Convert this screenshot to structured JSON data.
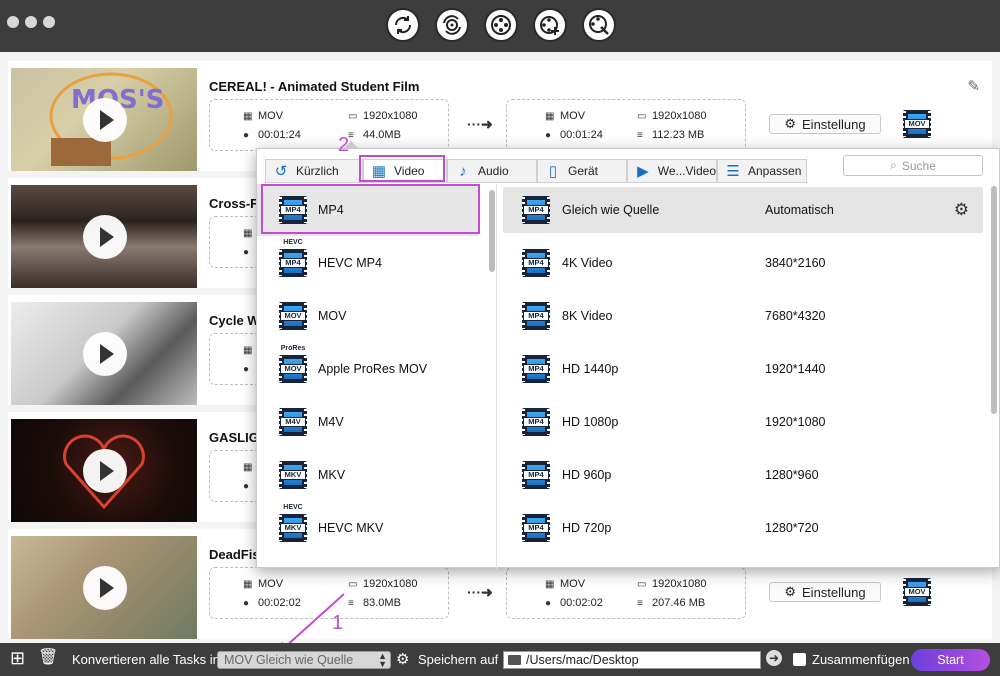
{
  "toolbar": {
    "icons": [
      "convert-icon",
      "rip-dvd-icon",
      "video-edit-icon",
      "merge-icon",
      "toolbox-icon"
    ]
  },
  "tasks": [
    {
      "title": "CEREAL! - Animated Student Film",
      "source": {
        "format": "MOV",
        "resolution": "1920x1080",
        "duration": "00:01:24",
        "size": "44.0MB"
      },
      "target": {
        "format": "MOV",
        "resolution": "1920x1080",
        "duration": "00:01:24",
        "size": "112.23 MB"
      },
      "settings_label": "Einstellung",
      "output_badge": "MOV"
    },
    {
      "title": "Cross-F",
      "source": {
        "format": "",
        "resolution": "",
        "duration": "",
        "size": ""
      }
    },
    {
      "title": "Cycle W",
      "source": {
        "format": "",
        "resolution": "",
        "duration": "",
        "size": ""
      }
    },
    {
      "title": "GASLIG",
      "source": {
        "format": "",
        "resolution": "",
        "duration": "",
        "size": ""
      }
    },
    {
      "title": "DeadFis",
      "source": {
        "format": "MOV",
        "resolution": "1920x1080",
        "duration": "00:02:02",
        "size": "83.0MB"
      },
      "target": {
        "format": "MOV",
        "resolution": "1920x1080",
        "duration": "00:02:02",
        "size": "207.46 MB"
      },
      "settings_label": "Einstellung",
      "output_badge": "MOV"
    }
  ],
  "popup": {
    "tabs": [
      "Kürzlich",
      "Video",
      "Audio",
      "Gerät",
      "We...Video",
      "Anpassen"
    ],
    "active_tab": "Video",
    "search_placeholder": "Suche",
    "formats": [
      {
        "label": "MP4",
        "badge": "MP4",
        "top": "",
        "selected": true
      },
      {
        "label": "HEVC MP4",
        "badge": "MP4",
        "top": "HEVC"
      },
      {
        "label": "MOV",
        "badge": "MOV",
        "top": ""
      },
      {
        "label": "Apple ProRes MOV",
        "badge": "MOV",
        "top": "ProRes"
      },
      {
        "label": "M4V",
        "badge": "M4V",
        "top": ""
      },
      {
        "label": "MKV",
        "badge": "MKV",
        "top": ""
      },
      {
        "label": "HEVC MKV",
        "badge": "MKV",
        "top": "HEVC"
      }
    ],
    "presets": [
      {
        "name": "Gleich wie Quelle",
        "resolution": "Automatisch",
        "badge": "MP4",
        "selected": true
      },
      {
        "name": "4K Video",
        "resolution": "3840*2160",
        "badge": "MP4"
      },
      {
        "name": "8K Video",
        "resolution": "7680*4320",
        "badge": "MP4"
      },
      {
        "name": "HD 1440p",
        "resolution": "1920*1440",
        "badge": "MP4"
      },
      {
        "name": "HD 1080p",
        "resolution": "1920*1080",
        "badge": "MP4"
      },
      {
        "name": "HD 960p",
        "resolution": "1280*960",
        "badge": "MP4"
      },
      {
        "name": "HD 720p",
        "resolution": "1280*720",
        "badge": "MP4"
      }
    ]
  },
  "bottom": {
    "convert_all_label": "Konvertieren alle Tasks in",
    "convert_all_value": "MOV Gleich wie Quelle",
    "save_label": "Speichern auf",
    "save_path": "/Users/mac/Desktop",
    "merge_label": "Zusammenfügen",
    "start_label": "Start"
  },
  "annotations": {
    "step1": "1",
    "step2": "2"
  },
  "colors": {
    "accent": "#c44ad4",
    "start_gradient_from": "#6b3fdb",
    "start_gradient_to": "#b44fdf",
    "titlebar": "#3d3d3d"
  }
}
